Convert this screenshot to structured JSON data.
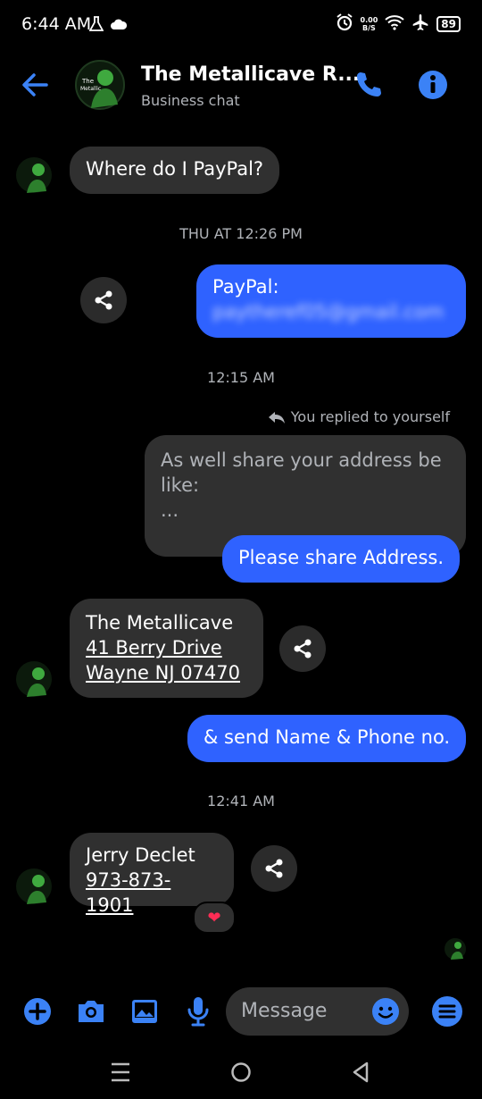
{
  "status": {
    "time": "6:44 AM",
    "speed_top": "0.00",
    "speed_bottom": "B/S",
    "battery": "89"
  },
  "header": {
    "title": "The Metallicave R...",
    "subtitle": "Business chat",
    "avatar_text": [
      "The",
      "Metallicave",
      "of BJJDb"
    ]
  },
  "messages": {
    "m1": "Where do I PayPal?",
    "ts1": "THU AT 12:26 PM",
    "m2_label": "PayPal:",
    "m2_hidden": "paytheref05@gmail.com",
    "ts2": "12:15 AM",
    "reply_note": "You replied to yourself",
    "reply_quote_line1": "As well share your address be",
    "reply_quote_line2": "like:",
    "reply_quote_line3": "...",
    "m3": "Please share Address.",
    "addr_line1": "The Metallicave",
    "addr_line2": "41 Berry Drive ",
    "addr_line3": "Wayne NJ 07470",
    "m4": "& send Name & Phone no.",
    "ts3": "12:41 AM",
    "contact_name": "Jerry Declet",
    "contact_phone": "973-873-1901",
    "reaction": "❤"
  },
  "composer": {
    "placeholder": "Message"
  },
  "colors": {
    "accent": "#2f62ff",
    "icon_blue": "#3b82f6",
    "incoming": "#303030"
  }
}
